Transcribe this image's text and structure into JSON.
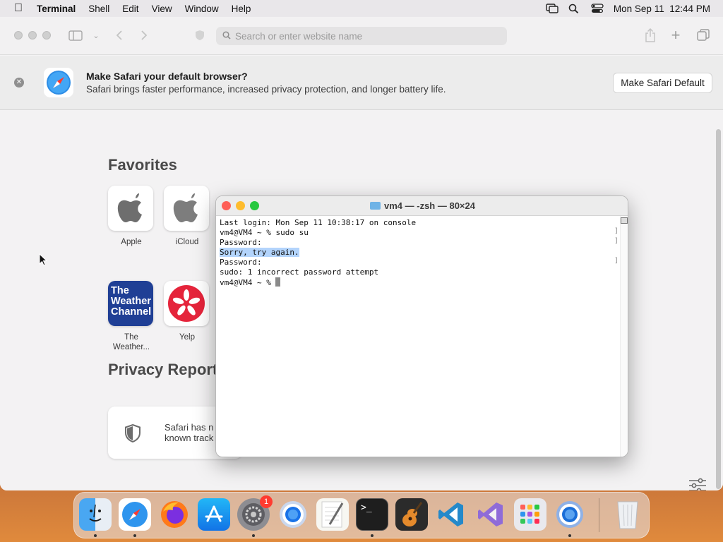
{
  "menubar": {
    "app_name": "Terminal",
    "menus": [
      "Shell",
      "Edit",
      "View",
      "Window",
      "Help"
    ],
    "clock": "Mon Sep 11  12:44 PM"
  },
  "safari": {
    "search_placeholder": "Search or enter website name",
    "banner": {
      "title": "Make Safari your default browser?",
      "subtitle": "Safari brings faster performance, increased privacy protection, and longer battery life.",
      "button_label": "Make Safari Default"
    },
    "favorites": {
      "title": "Favorites",
      "items": [
        {
          "label": "Apple",
          "icon": "apple-logo-icon"
        },
        {
          "label": "iCloud",
          "icon": "apple-logo-icon"
        },
        {
          "label": "The Weather...",
          "icon": "weather-channel-logo",
          "logo_text": "The Weather Channel"
        },
        {
          "label": "Yelp",
          "icon": "yelp-logo-icon"
        }
      ]
    },
    "privacy": {
      "title": "Privacy Report",
      "text_line1": "Safari has n",
      "text_line2": "known track"
    }
  },
  "terminal": {
    "title": "vm4 — -zsh — 80×24",
    "lines": [
      "Last login: Mon Sep 11 10:38:17 on console",
      "vm4@VM4 ~ % sudo su",
      "Password:",
      "Sorry, try again.",
      "Password:",
      "sudo: 1 incorrect password attempt",
      "vm4@VM4 ~ % "
    ],
    "highlighted_line_index": 3
  },
  "dock": {
    "apps": [
      "Finder",
      "Safari",
      "Firefox",
      "App Store",
      "System Settings",
      "Chrome",
      "TextEdit",
      "Terminal",
      "GarageBand",
      "Visual Studio Code",
      "Visual Studio",
      "Launchpad",
      "Chromium",
      "Trash"
    ],
    "settings_badge": "1"
  },
  "colors": {
    "accent_blue": "#1a73e8",
    "traffic_red": "#fe5f57",
    "traffic_yellow": "#febc2e",
    "traffic_green": "#28c840",
    "selection": "#b3d4fc"
  }
}
